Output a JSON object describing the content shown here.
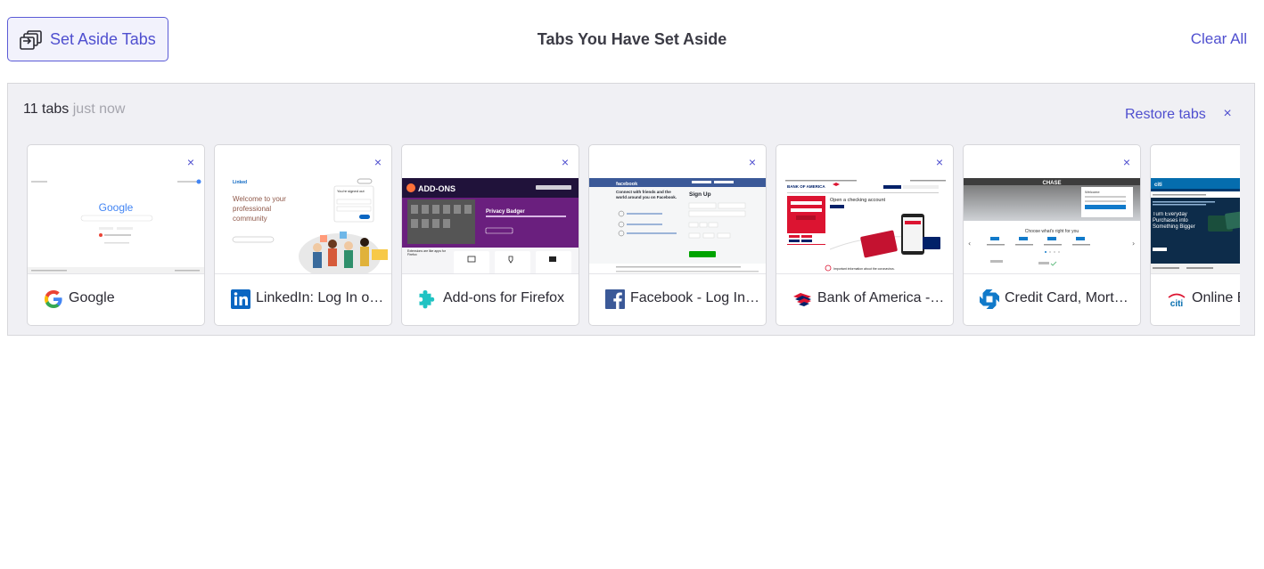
{
  "header": {
    "set_aside_label": "Set Aside Tabs",
    "title": "Tabs You Have Set Aside",
    "clear_all_label": "Clear All"
  },
  "group": {
    "count_label": "11 tabs",
    "time_label": "just now",
    "restore_label": "Restore tabs",
    "close_glyph": "×"
  },
  "cards": [
    {
      "title": "Google",
      "favicon": "google-g-icon",
      "close_glyph": "×"
    },
    {
      "title": "LinkedIn: Log In or Sign Up",
      "favicon": "linkedin-icon",
      "close_glyph": "×"
    },
    {
      "title": "Add-ons for Firefox",
      "favicon": "puzzle-piece-icon",
      "close_glyph": "×"
    },
    {
      "title": "Facebook - Log In or Sign Up",
      "favicon": "facebook-icon",
      "close_glyph": "×"
    },
    {
      "title": "Bank of America - Banking",
      "favicon": "bank-of-america-flag-icon",
      "close_glyph": "×"
    },
    {
      "title": "Credit Card, Mortgage, Banking",
      "favicon": "chase-octagon-icon",
      "close_glyph": "×"
    },
    {
      "title": "Online Banking",
      "favicon": "citi-icon",
      "close_glyph": "×"
    }
  ],
  "thumbs": {
    "google_logo": "Google",
    "linkedin_logo": "Linked",
    "linkedin_welcome": "Welcome to your professional community",
    "linkedin_signin": "You're signed out",
    "addons_banner": "ADD-ONS",
    "addons_feature": "Privacy Badger",
    "addons_tagline": "Extensions are like apps for Firefox",
    "facebook_logo": "facebook",
    "facebook_tagline": "Connect with friends and the world around you on Facebook.",
    "facebook_signup": "Sign Up",
    "boa_logo": "BANK OF AMERICA",
    "boa_headline": "Open a checking account",
    "boa_alert": "Important information about the coronavirus.",
    "chase_logo": "CHASE",
    "chase_welcome": "Welcome",
    "chase_choose": "Choose what's right for you",
    "citi_logo": "citi",
    "citi_headline": "Turn Everyday Purchases into Something Bigger"
  },
  "colors": {
    "accent": "#4f4fcf",
    "group_bg": "#f0f0f4",
    "muted": "#a5a5ad",
    "addons_purple": "#6a1f7e",
    "facebook_blue": "#3b5998",
    "boa_red": "#dc1431",
    "chase_blue": "#117aca",
    "citi_blue": "#056dae"
  }
}
